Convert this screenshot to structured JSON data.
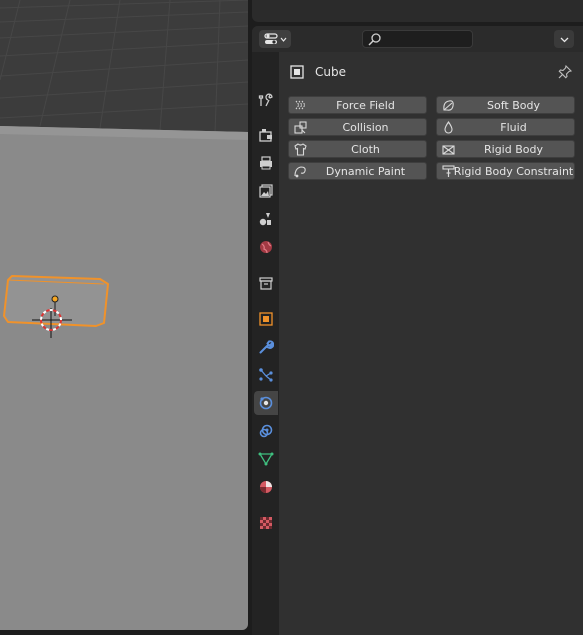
{
  "properties": {
    "object_name": "Cube",
    "physics_buttons": [
      {
        "label": "Force Field",
        "icon": "force-field-icon"
      },
      {
        "label": "Soft Body",
        "icon": "soft-body-icon"
      },
      {
        "label": "Collision",
        "icon": "collision-icon"
      },
      {
        "label": "Fluid",
        "icon": "fluid-icon"
      },
      {
        "label": "Cloth",
        "icon": "cloth-icon"
      },
      {
        "label": "Rigid Body",
        "icon": "rigid-body-icon"
      },
      {
        "label": "Dynamic Paint",
        "icon": "dynamic-paint-icon"
      },
      {
        "label": "Rigid Body Constraint",
        "icon": "rigid-body-constraint-icon"
      }
    ],
    "tabs": [
      "tool",
      "render",
      "output",
      "view-layer",
      "scene",
      "world",
      "collection",
      "object",
      "modifiers",
      "particles",
      "physics",
      "constraints",
      "data",
      "material",
      "texture"
    ],
    "active_tab": "physics"
  },
  "colors": {
    "accent_blue": "#4a8fd6",
    "selection_orange": "#f0922a",
    "panel_bg": "#303030",
    "button_bg": "#545454"
  }
}
